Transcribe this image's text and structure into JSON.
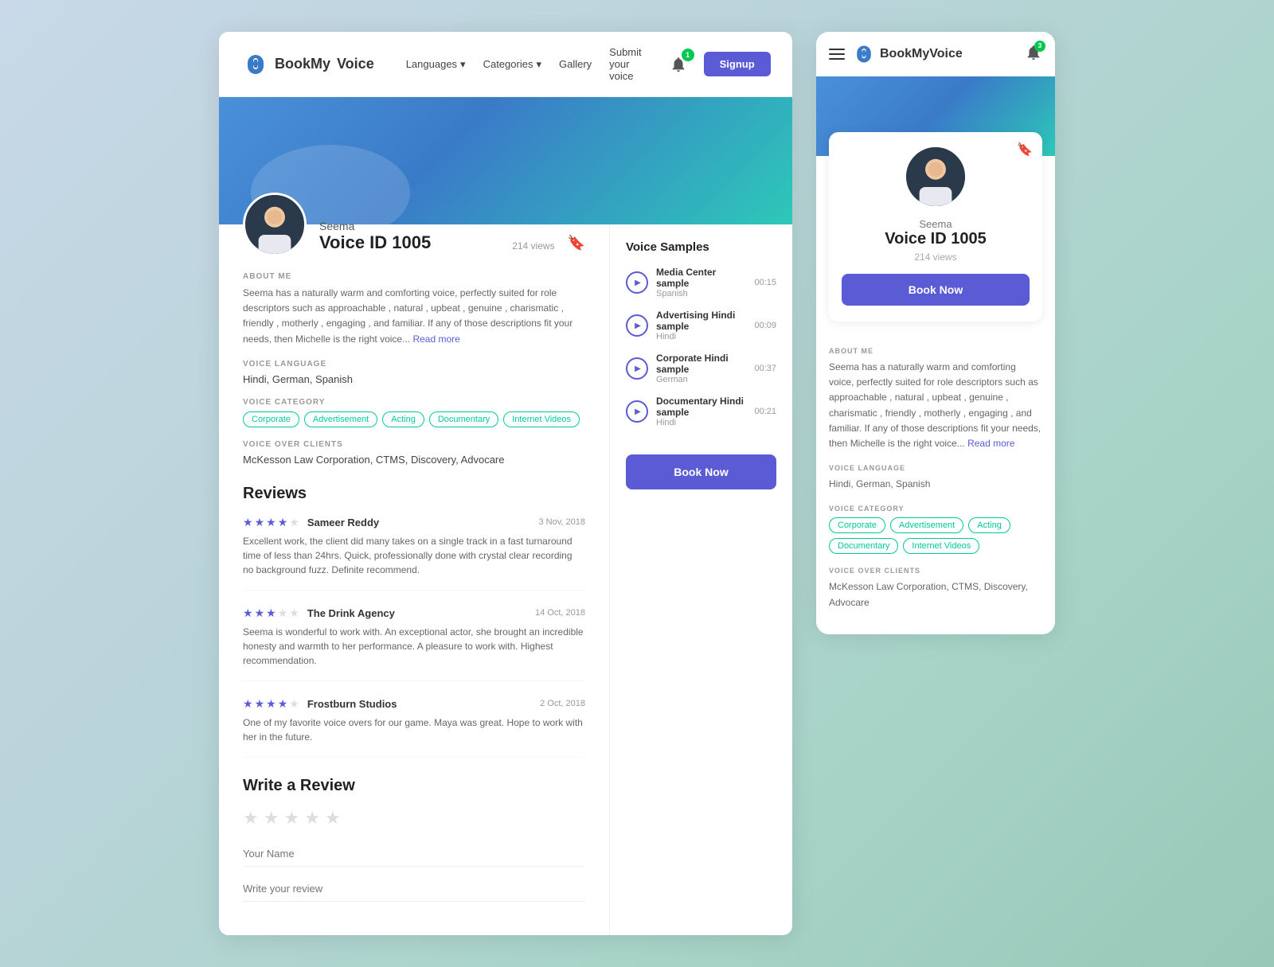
{
  "brand": {
    "name_part1": "BookMy",
    "name_part2": "Voice",
    "logo_icon": "🎙️"
  },
  "desktop": {
    "nav": {
      "languages_label": "Languages",
      "categories_label": "Categories",
      "gallery_label": "Gallery",
      "submit_voice_label": "Submit your voice",
      "notification_count": "1",
      "signup_label": "Signup"
    },
    "profile": {
      "name": "Seema",
      "voice_id": "Voice ID 1005",
      "views": "214 views",
      "about_label": "ABOUT ME",
      "about_text": "Seema has a naturally warm and comforting voice, perfectly suited for role descriptors such as approachable , natural , upbeat , genuine , charismatic , friendly , motherly , engaging , and familiar. If any of those descriptions fit your needs, then Michelle is the right voice...",
      "read_more": "Read more",
      "language_label": "VOICE LANGUAGE",
      "language_text": "Hindi, German, Spanish",
      "category_label": "VOICE CATEGORY",
      "tags": [
        "Corporate",
        "Advertisement",
        "Acting",
        "Documentary",
        "Internet Videos"
      ],
      "clients_label": "VOICE OVER CLIENTS",
      "clients_text": "McKesson Law Corporation, CTMS, Discovery, Advocare",
      "reviews_title": "Reviews",
      "reviews": [
        {
          "reviewer": "Sameer Reddy",
          "date": "3 Nov, 2018",
          "stars": 4,
          "max_stars": 5,
          "text": "Excellent work, the client did many takes on a single track in a fast turnaround time of less than 24hrs. Quick, professionally done with crystal clear recording no background fuzz. Definite recommend."
        },
        {
          "reviewer": "The Drink Agency",
          "date": "14 Oct, 2018",
          "stars": 3,
          "max_stars": 5,
          "text": "Seema is wonderful to work with. An exceptional actor, she brought an incredible honesty and warmth to her performance. A pleasure to work with. Highest recommendation."
        },
        {
          "reviewer": "Frostburn Studios",
          "date": "2 Oct, 2018",
          "stars": 4,
          "max_stars": 5,
          "text": "One of my favorite voice overs for our game. Maya was great. Hope to work with her in the future."
        }
      ],
      "write_review_title": "Write a Review",
      "name_placeholder": "Your Name",
      "review_placeholder": "Write your review"
    },
    "voice_samples": {
      "title": "Voice Samples",
      "samples": [
        {
          "name": "Media Center sample",
          "language": "Spanish",
          "duration": "00:15"
        },
        {
          "name": "Advertising Hindi sample",
          "language": "Hindi",
          "duration": "00:09"
        },
        {
          "name": "Corporate Hindi sample",
          "language": "German",
          "duration": "00:37"
        },
        {
          "name": "Documentary Hindi sample",
          "language": "Hindi",
          "duration": "00:21"
        }
      ],
      "book_now_label": "Book Now"
    }
  },
  "mobile": {
    "nav": {
      "notification_count": "3"
    },
    "profile": {
      "name": "Seema",
      "voice_id": "Voice ID 1005",
      "views": "214 views",
      "book_now_label": "Book Now",
      "about_label": "ABOUT ME",
      "about_text": "Seema has a naturally warm and comforting voice, perfectly suited for role descriptors such as approachable , natural , upbeat , genuine , charismatic , friendly , motherly , engaging , and familiar. If any of those descriptions fit your needs, then Michelle is the right voice...",
      "read_more": "Read more",
      "language_label": "VOICE LANGUAGE",
      "language_text": "Hindi, German, Spanish",
      "category_label": "VOICE CATEGORY",
      "tags": [
        "Corporate",
        "Advertisement",
        "Acting",
        "Documentary",
        "Internet Videos"
      ],
      "clients_label": "VOICE OVER CLIENTS",
      "clients_text": "McKesson Law Corporation, CTMS, Discovery, Advocare"
    }
  }
}
